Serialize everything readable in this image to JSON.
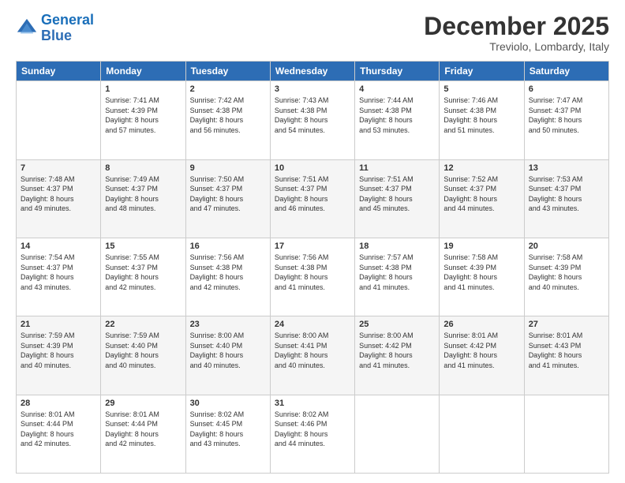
{
  "header": {
    "logo_line1": "General",
    "logo_line2": "Blue",
    "title": "December 2025",
    "subtitle": "Treviolo, Lombardy, Italy"
  },
  "days_of_week": [
    "Sunday",
    "Monday",
    "Tuesday",
    "Wednesday",
    "Thursday",
    "Friday",
    "Saturday"
  ],
  "weeks": [
    [
      {
        "day": "",
        "info": ""
      },
      {
        "day": "1",
        "info": "Sunrise: 7:41 AM\nSunset: 4:39 PM\nDaylight: 8 hours\nand 57 minutes."
      },
      {
        "day": "2",
        "info": "Sunrise: 7:42 AM\nSunset: 4:38 PM\nDaylight: 8 hours\nand 56 minutes."
      },
      {
        "day": "3",
        "info": "Sunrise: 7:43 AM\nSunset: 4:38 PM\nDaylight: 8 hours\nand 54 minutes."
      },
      {
        "day": "4",
        "info": "Sunrise: 7:44 AM\nSunset: 4:38 PM\nDaylight: 8 hours\nand 53 minutes."
      },
      {
        "day": "5",
        "info": "Sunrise: 7:46 AM\nSunset: 4:38 PM\nDaylight: 8 hours\nand 51 minutes."
      },
      {
        "day": "6",
        "info": "Sunrise: 7:47 AM\nSunset: 4:37 PM\nDaylight: 8 hours\nand 50 minutes."
      }
    ],
    [
      {
        "day": "7",
        "info": "Sunrise: 7:48 AM\nSunset: 4:37 PM\nDaylight: 8 hours\nand 49 minutes."
      },
      {
        "day": "8",
        "info": "Sunrise: 7:49 AM\nSunset: 4:37 PM\nDaylight: 8 hours\nand 48 minutes."
      },
      {
        "day": "9",
        "info": "Sunrise: 7:50 AM\nSunset: 4:37 PM\nDaylight: 8 hours\nand 47 minutes."
      },
      {
        "day": "10",
        "info": "Sunrise: 7:51 AM\nSunset: 4:37 PM\nDaylight: 8 hours\nand 46 minutes."
      },
      {
        "day": "11",
        "info": "Sunrise: 7:51 AM\nSunset: 4:37 PM\nDaylight: 8 hours\nand 45 minutes."
      },
      {
        "day": "12",
        "info": "Sunrise: 7:52 AM\nSunset: 4:37 PM\nDaylight: 8 hours\nand 44 minutes."
      },
      {
        "day": "13",
        "info": "Sunrise: 7:53 AM\nSunset: 4:37 PM\nDaylight: 8 hours\nand 43 minutes."
      }
    ],
    [
      {
        "day": "14",
        "info": "Sunrise: 7:54 AM\nSunset: 4:37 PM\nDaylight: 8 hours\nand 43 minutes."
      },
      {
        "day": "15",
        "info": "Sunrise: 7:55 AM\nSunset: 4:37 PM\nDaylight: 8 hours\nand 42 minutes."
      },
      {
        "day": "16",
        "info": "Sunrise: 7:56 AM\nSunset: 4:38 PM\nDaylight: 8 hours\nand 42 minutes."
      },
      {
        "day": "17",
        "info": "Sunrise: 7:56 AM\nSunset: 4:38 PM\nDaylight: 8 hours\nand 41 minutes."
      },
      {
        "day": "18",
        "info": "Sunrise: 7:57 AM\nSunset: 4:38 PM\nDaylight: 8 hours\nand 41 minutes."
      },
      {
        "day": "19",
        "info": "Sunrise: 7:58 AM\nSunset: 4:39 PM\nDaylight: 8 hours\nand 41 minutes."
      },
      {
        "day": "20",
        "info": "Sunrise: 7:58 AM\nSunset: 4:39 PM\nDaylight: 8 hours\nand 40 minutes."
      }
    ],
    [
      {
        "day": "21",
        "info": "Sunrise: 7:59 AM\nSunset: 4:39 PM\nDaylight: 8 hours\nand 40 minutes."
      },
      {
        "day": "22",
        "info": "Sunrise: 7:59 AM\nSunset: 4:40 PM\nDaylight: 8 hours\nand 40 minutes."
      },
      {
        "day": "23",
        "info": "Sunrise: 8:00 AM\nSunset: 4:40 PM\nDaylight: 8 hours\nand 40 minutes."
      },
      {
        "day": "24",
        "info": "Sunrise: 8:00 AM\nSunset: 4:41 PM\nDaylight: 8 hours\nand 40 minutes."
      },
      {
        "day": "25",
        "info": "Sunrise: 8:00 AM\nSunset: 4:42 PM\nDaylight: 8 hours\nand 41 minutes."
      },
      {
        "day": "26",
        "info": "Sunrise: 8:01 AM\nSunset: 4:42 PM\nDaylight: 8 hours\nand 41 minutes."
      },
      {
        "day": "27",
        "info": "Sunrise: 8:01 AM\nSunset: 4:43 PM\nDaylight: 8 hours\nand 41 minutes."
      }
    ],
    [
      {
        "day": "28",
        "info": "Sunrise: 8:01 AM\nSunset: 4:44 PM\nDaylight: 8 hours\nand 42 minutes."
      },
      {
        "day": "29",
        "info": "Sunrise: 8:01 AM\nSunset: 4:44 PM\nDaylight: 8 hours\nand 42 minutes."
      },
      {
        "day": "30",
        "info": "Sunrise: 8:02 AM\nSunset: 4:45 PM\nDaylight: 8 hours\nand 43 minutes."
      },
      {
        "day": "31",
        "info": "Sunrise: 8:02 AM\nSunset: 4:46 PM\nDaylight: 8 hours\nand 44 minutes."
      },
      {
        "day": "",
        "info": ""
      },
      {
        "day": "",
        "info": ""
      },
      {
        "day": "",
        "info": ""
      }
    ]
  ]
}
